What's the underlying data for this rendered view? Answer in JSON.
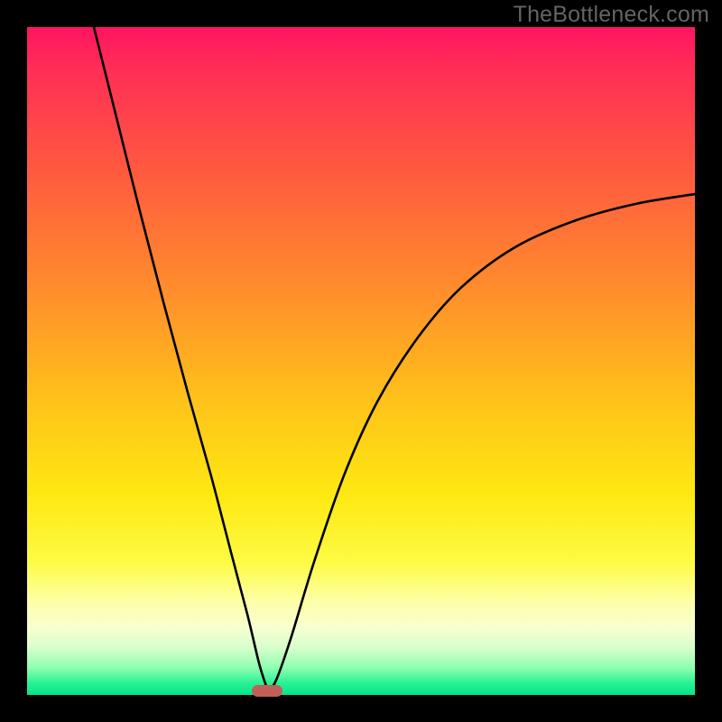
{
  "watermark": "TheBottleneck.com",
  "marker": {
    "center_x_frac": 0.3595,
    "bottom_frac": 0.994
  },
  "chart_data": {
    "type": "line",
    "title": "",
    "xlabel": "",
    "ylabel": "",
    "xlim": [
      0,
      1
    ],
    "ylim": [
      0,
      1
    ],
    "note": "Axes are unlabeled; x and y given as fractions of the plot area (origin at bottom-left). The curve is a V-shaped function touching y≈0 near x≈0.36; left branch starts at top edge near x≈0.10, right branch exits right edge near y≈0.75.",
    "series": [
      {
        "name": "curve",
        "x": [
          0.1,
          0.135,
          0.17,
          0.205,
          0.24,
          0.275,
          0.305,
          0.33,
          0.348,
          0.36,
          0.372,
          0.395,
          0.43,
          0.475,
          0.525,
          0.585,
          0.65,
          0.73,
          0.82,
          0.91,
          1.0
        ],
        "y": [
          1.0,
          0.86,
          0.72,
          0.585,
          0.455,
          0.33,
          0.215,
          0.12,
          0.045,
          0.008,
          0.02,
          0.085,
          0.2,
          0.33,
          0.44,
          0.535,
          0.61,
          0.67,
          0.71,
          0.735,
          0.75
        ]
      }
    ],
    "background_gradient_stops": [
      {
        "pos": 0.0,
        "color": "#ff1462"
      },
      {
        "pos": 0.22,
        "color": "#ff5b3f"
      },
      {
        "pos": 0.56,
        "color": "#ffc21a"
      },
      {
        "pos": 0.8,
        "color": "#fdfb43"
      },
      {
        "pos": 0.93,
        "color": "#d6ffcb"
      },
      {
        "pos": 1.0,
        "color": "#06e58a"
      }
    ],
    "marker": {
      "x": 0.3595,
      "y": 0.006,
      "color": "#c06058",
      "shape": "rounded-bar"
    }
  }
}
